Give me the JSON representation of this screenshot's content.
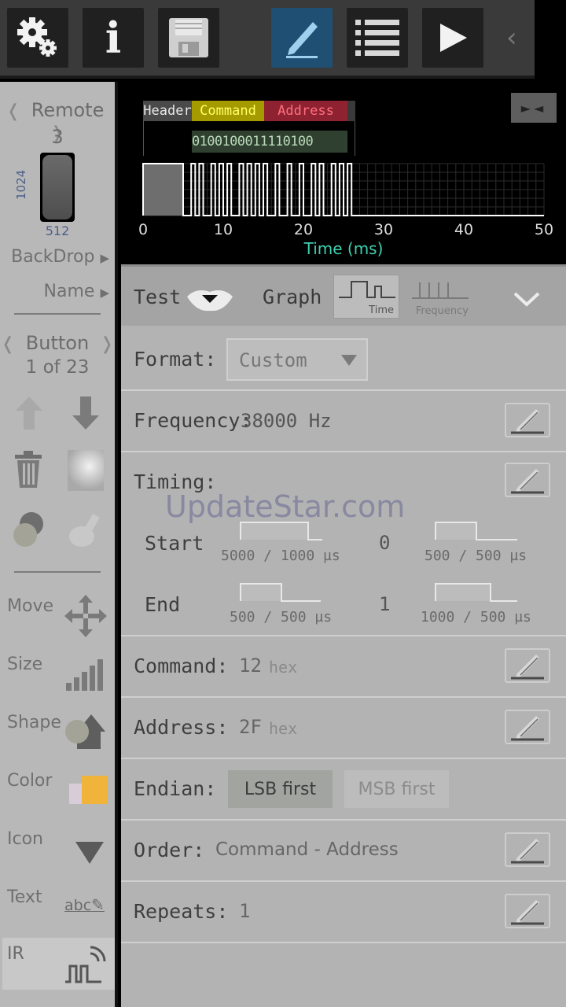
{
  "toolbar": {
    "buttons": [
      {
        "icon": "gear-icon"
      },
      {
        "icon": "info-icon",
        "label": "i"
      },
      {
        "icon": "save-icon"
      },
      {
        "icon": "pencil-icon",
        "active": true
      },
      {
        "icon": "list-icon"
      },
      {
        "icon": "play-icon"
      }
    ],
    "more": "‹"
  },
  "sidebar": {
    "remote_label": "Remote",
    "remote_number": "3",
    "dim_width": "512",
    "dim_height": "1024",
    "backdrop": "BackDrop",
    "name": "Name",
    "button_label": "Button",
    "button_count": "1 of 23",
    "tools": [
      "Move",
      "Size",
      "Shape",
      "Color",
      "Icon",
      "Text",
      "IR"
    ]
  },
  "graph": {
    "segments": {
      "header": "Header",
      "command": "Command",
      "address": "Address"
    },
    "bits": "0100100011110100",
    "x_ticks": [
      "0",
      "10",
      "20",
      "30",
      "40",
      "50"
    ],
    "x_label": "Time (ms)"
  },
  "panel": {
    "tabs": {
      "test": "Test",
      "graph": "Graph",
      "time": "Time",
      "frequency": "Frequency"
    },
    "format_label": "Format:",
    "format_value": "Custom",
    "frequency_label": "Frequency:",
    "frequency_value": "38000 Hz",
    "timing_label": "Timing:",
    "watermark": "UpdateStar.com",
    "start_label": "Start",
    "start_mark": "5000 / 1000 µs",
    "start_bit": "0",
    "start_space": "500 / 500 µs",
    "end_label": "End",
    "end_mark": "500 / 500 µs",
    "end_bit": "1",
    "end_space": "1000 / 500 µs",
    "command_label": "Command:",
    "command_value": "12",
    "command_unit": "hex",
    "address_label": "Address:",
    "address_value": "2F",
    "address_unit": "hex",
    "endian_label": "Endian:",
    "lsb_label": "LSB first",
    "msb_label": "MSB first",
    "order_label": "Order:",
    "order_value": "Command - Address",
    "repeats_label": "Repeats:",
    "repeats_value": "1"
  },
  "colors": {
    "accent": "#2a5a80",
    "command": "#b5a800",
    "address": "#9c2330"
  }
}
